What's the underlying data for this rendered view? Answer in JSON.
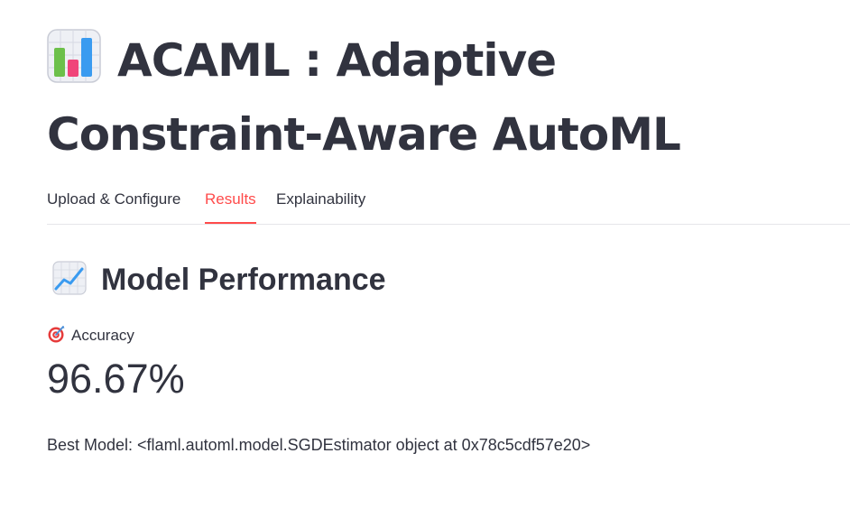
{
  "header": {
    "title": "ACAML : Adaptive Constraint-Aware AutoML",
    "title_icon": "bar-chart-icon"
  },
  "tabs": [
    {
      "label": "Upload & Configure",
      "active": false
    },
    {
      "label": "Results",
      "active": true
    },
    {
      "label": "Explainability",
      "active": false
    }
  ],
  "colors": {
    "accent": "#ff4b4b",
    "text": "#31333f",
    "divider": "#e6e6ea"
  },
  "results": {
    "subheader": "Model Performance",
    "subheader_icon": "chart-increasing-icon",
    "metric": {
      "label": "Accuracy",
      "label_icon": "target-icon",
      "value": "96.67%"
    },
    "best_model_text": "Best Model: <flaml.automl.model.SGDEstimator object at 0x78c5cdf57e20>"
  }
}
